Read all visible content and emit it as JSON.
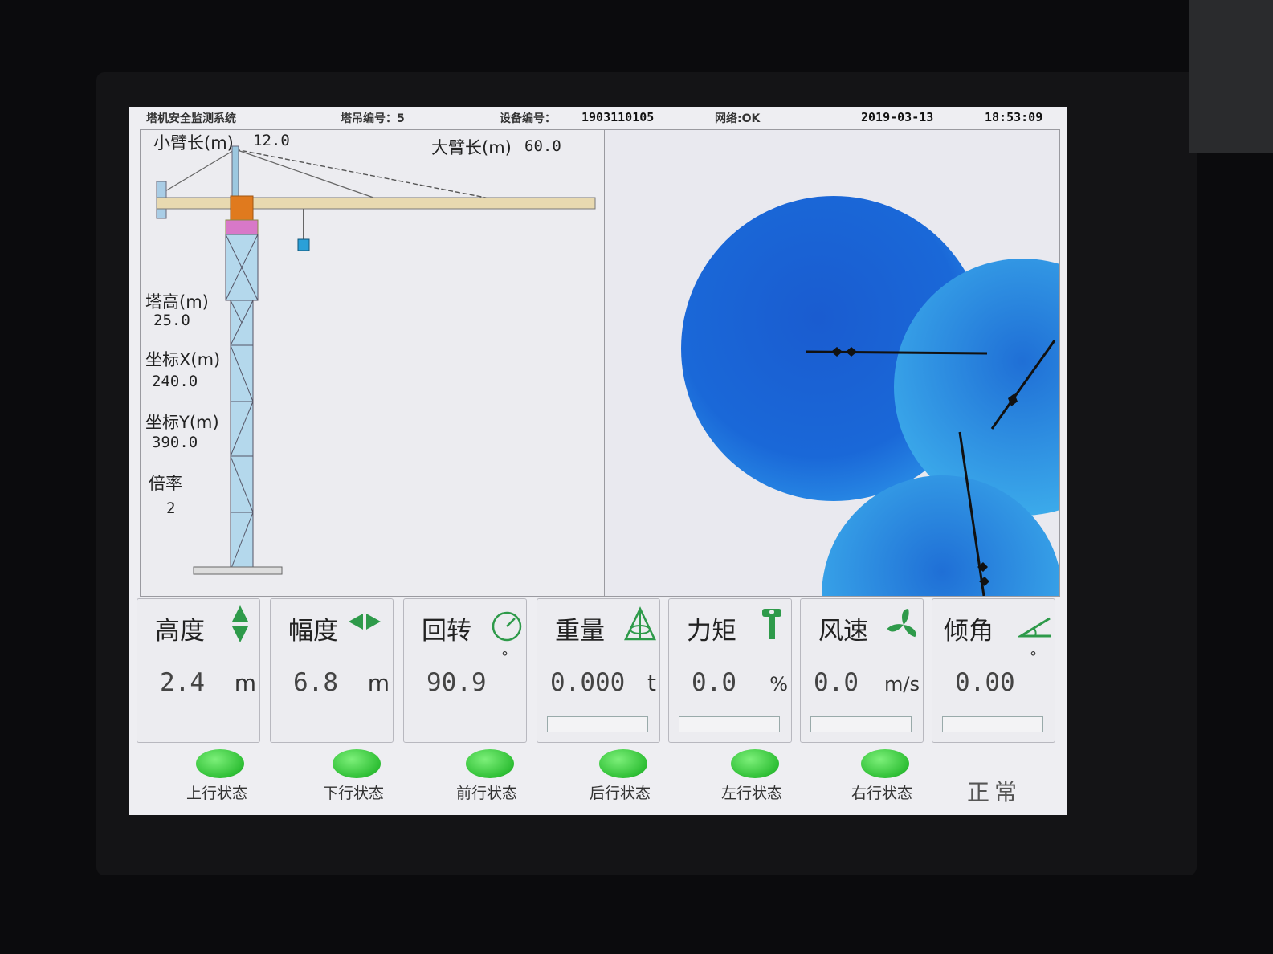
{
  "titlebar": {
    "system_name": "塔机安全监测系统",
    "crane_no": "塔吊编号：5",
    "device_label": "设备编号：",
    "device_no": "1903110105",
    "network": "网络:OK",
    "date": "2019-03-13",
    "time": "18:53:09"
  },
  "crane": {
    "small_arm_label": "小臂长(m)",
    "small_arm_value": "12.0",
    "big_arm_label": "大臂长(m)",
    "big_arm_value": "60.0",
    "tower_height_label": "塔高(m)",
    "tower_height_value": "25.0",
    "coord_x_label": "坐标X(m)",
    "coord_x_value": "240.0",
    "coord_y_label": "坐标Y(m)",
    "coord_y_value": "390.0",
    "ratio_label": "倍率",
    "ratio_value": "2"
  },
  "gauges": [
    {
      "name": "高度",
      "value": "2.4",
      "unit": "m",
      "icon": "up-down-arrows-icon"
    },
    {
      "name": "幅度",
      "value": "6.8",
      "unit": "m",
      "icon": "left-right-arrows-icon"
    },
    {
      "name": "回转",
      "value": "90.9",
      "unit": "°",
      "icon": "rotation-dial-icon"
    },
    {
      "name": "重量",
      "value": "0.000",
      "unit": "t",
      "icon": "weight-icon",
      "level": 0
    },
    {
      "name": "力矩",
      "value": "0.0",
      "unit": "%",
      "icon": "torque-icon",
      "level": 0
    },
    {
      "name": "风速",
      "value": "0.0",
      "unit": "m/s",
      "icon": "fan-icon",
      "level": 0
    },
    {
      "name": "倾角",
      "value": "0.00",
      "unit": "°",
      "icon": "tilt-angle-icon",
      "level": 0
    }
  ],
  "statuses": [
    {
      "label": "上行状态",
      "color": "#3cd24a"
    },
    {
      "label": "下行状态",
      "color": "#3cd24a"
    },
    {
      "label": "前行状态",
      "color": "#3cd24a"
    },
    {
      "label": "后行状态",
      "color": "#3cd24a"
    },
    {
      "label": "左行状态",
      "color": "#3cd24a"
    },
    {
      "label": "右行状态",
      "color": "#3cd24a"
    }
  ],
  "overall_status": "正常",
  "colors": {
    "zone_blue": "#1f6fd6",
    "led_green": "#3cd24a",
    "counterweight_orange": "#e07a1e",
    "hook_cyan": "#2aa0d8"
  }
}
